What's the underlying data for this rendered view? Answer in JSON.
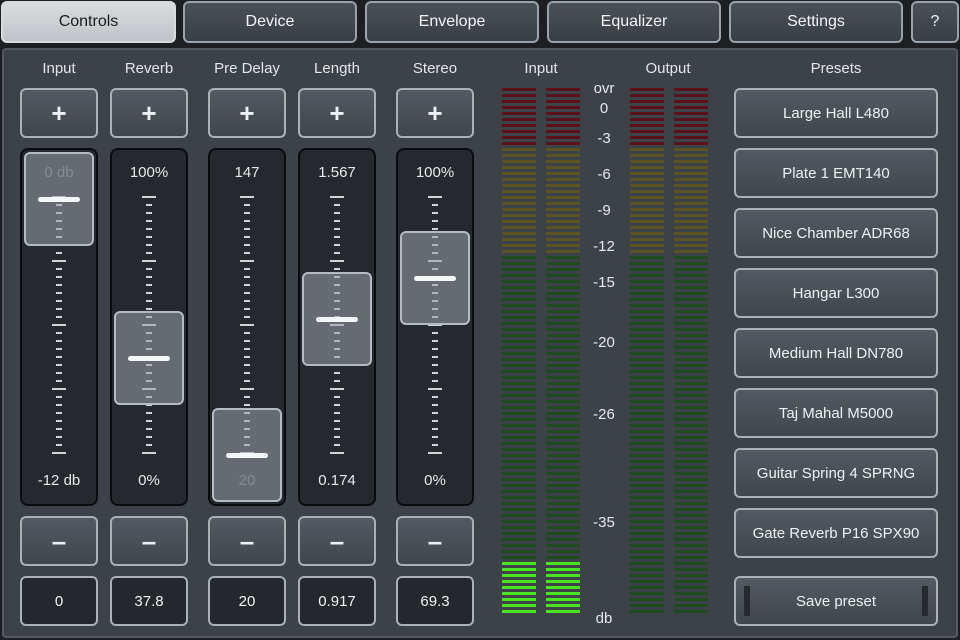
{
  "tabs": [
    {
      "label": "Controls",
      "active": true
    },
    {
      "label": "Device",
      "active": false
    },
    {
      "label": "Envelope",
      "active": false
    },
    {
      "label": "Equalizer",
      "active": false
    },
    {
      "label": "Settings",
      "active": false
    },
    {
      "label": "?",
      "active": false
    }
  ],
  "plus_symbol": "+",
  "minus_symbol": "–",
  "sliders": [
    {
      "label": "Input",
      "top_text": "0 db",
      "bottom_text": "-12 db",
      "value": "0",
      "level": 1.0,
      "top_dim": true,
      "bottom_dim": false
    },
    {
      "label": "Reverb",
      "top_text": "100%",
      "bottom_text": "0%",
      "value": "37.8",
      "level": 0.378,
      "top_dim": false,
      "bottom_dim": false
    },
    {
      "label": "Pre Delay",
      "top_text": "147",
      "bottom_text": "20",
      "value": "20",
      "level": 0.0,
      "top_dim": false,
      "bottom_dim": true
    },
    {
      "label": "Length",
      "top_text": "1.567",
      "bottom_text": "0.174",
      "value": "0.917",
      "level": 0.533,
      "top_dim": false,
      "bottom_dim": false
    },
    {
      "label": "Stereo",
      "top_text": "100%",
      "bottom_text": "0%",
      "value": "69.3",
      "level": 0.693,
      "top_dim": false,
      "bottom_dim": false
    }
  ],
  "meters": {
    "input_label": "Input",
    "output_label": "Output",
    "scale": [
      "ovr",
      "0",
      "-3",
      "-6",
      "-9",
      "-12",
      "-15",
      "-20",
      "-26",
      "-35",
      "db"
    ],
    "input_lit_fraction": 0.1,
    "output_lit_fraction": 0.0,
    "colors": {
      "red": "#5a1218",
      "yellow": "#5a5424",
      "green": "#1f4a20",
      "green_lit": "#49e41f"
    }
  },
  "presets": {
    "title": "Presets",
    "items": [
      "Large Hall L480",
      "Plate 1 EMT140",
      "Nice Chamber ADR68",
      "Hangar L300",
      "Medium Hall DN780",
      "Taj Mahal M5000",
      "Guitar Spring 4 SPRNG",
      "Gate Reverb P16 SPX90"
    ],
    "save_label": "Save preset"
  }
}
